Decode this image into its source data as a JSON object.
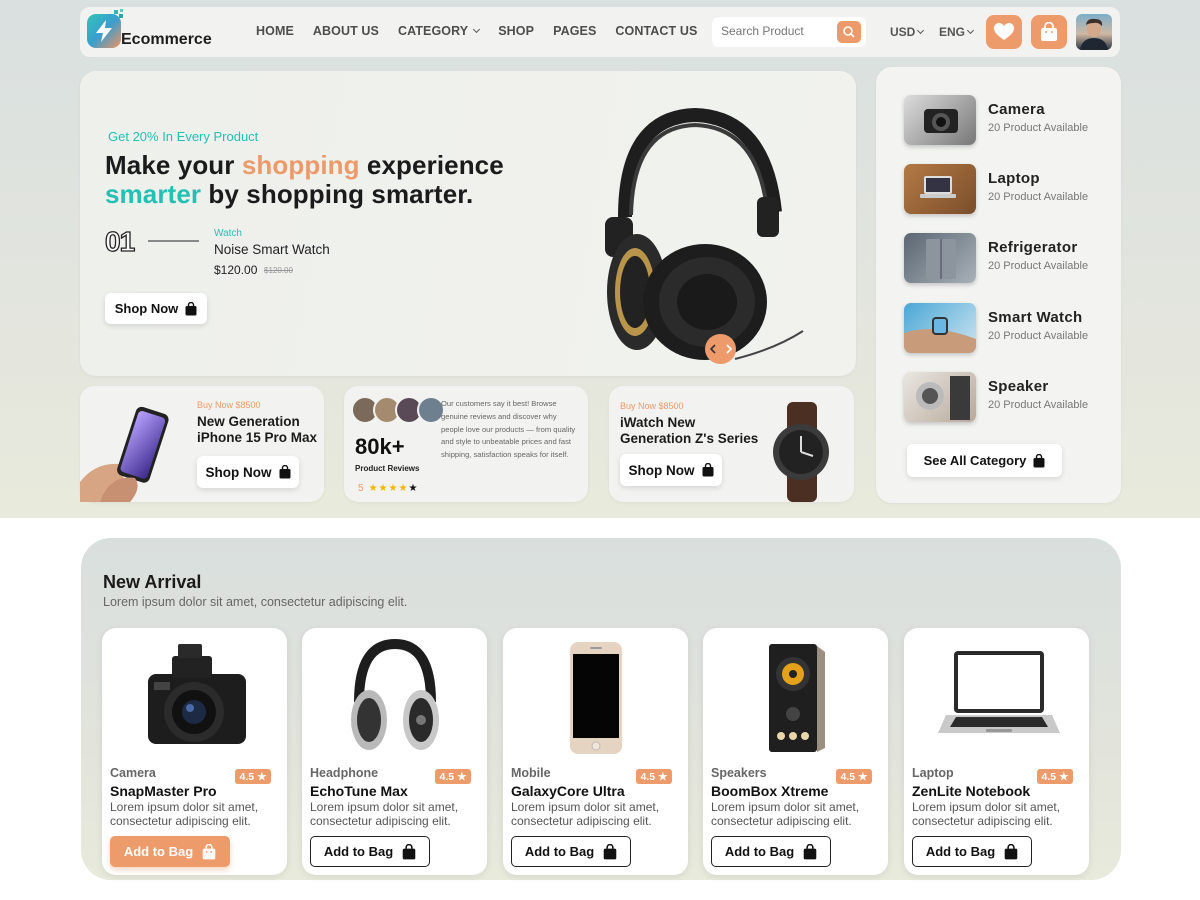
{
  "header": {
    "logo_text": "Ecommerce",
    "nav": [
      {
        "label": "HOME",
        "has_dropdown": false
      },
      {
        "label": "ABOUT US",
        "has_dropdown": false
      },
      {
        "label": "CATEGORY",
        "has_dropdown": true
      },
      {
        "label": "SHOP",
        "has_dropdown": false
      },
      {
        "label": "PAGES",
        "has_dropdown": false
      },
      {
        "label": "CONTACT US",
        "has_dropdown": false
      }
    ],
    "search_placeholder": "Search Product",
    "currency": "USD",
    "language": "ENG"
  },
  "hero": {
    "promo": "Get 20% In Every Product",
    "headline": {
      "part1": "Make your ",
      "highlight1": "shopping",
      "part2": " experience",
      "highlight2": "smarter",
      "part3": " by shopping smarter."
    },
    "slide_number": "01",
    "product_category": "Watch",
    "product_name": "Noise Smart Watch",
    "price": "$120.00",
    "old_price": "$120.00",
    "button": "Shop Now"
  },
  "categories": {
    "items": [
      {
        "name": "Camera",
        "count": "20 Product Available"
      },
      {
        "name": "Laptop",
        "count": "20 Product Available"
      },
      {
        "name": "Refrigerator",
        "count": "20 Product Available"
      },
      {
        "name": "Smart Watch",
        "count": "20 Product Available"
      },
      {
        "name": "Speaker",
        "count": "20 Product Available"
      }
    ],
    "see_all": "See All Category"
  },
  "promo_cards": {
    "iphone": {
      "buy": "Buy Now $8500",
      "title_line1": "New Generation",
      "title_line2": "iPhone 15 Pro Max",
      "button": "Shop Now"
    },
    "reviews": {
      "count": "80k+",
      "label": "Product Reviews",
      "rating": "5",
      "stars": 5,
      "text": "Our customers say it best! Browse genuine reviews and discover why people love our products — from quality and style to unbeatable prices and fast shipping, satisfaction speaks for itself."
    },
    "iwatch": {
      "buy": "Buy Now $8500",
      "title_line1": "iWatch New",
      "title_line2": "Generation  Z's Series",
      "button": "Shop Now"
    }
  },
  "new_arrival": {
    "title": "New Arrival",
    "subtitle": "Lorem ipsum dolor sit amet, consectetur adipiscing elit.",
    "products": [
      {
        "category": "Camera",
        "name": "SnapMaster Pro",
        "rating": "4.5",
        "desc": "Lorem ipsum dolor sit amet, consectetur adipiscing elit.",
        "button": "Add to Bag",
        "icon": "camera"
      },
      {
        "category": "Headphone",
        "name": "EchoTune Max",
        "rating": "4.5",
        "desc": "Lorem ipsum dolor sit amet, consectetur adipiscing elit.",
        "button": "Add to Bag",
        "icon": "headphone"
      },
      {
        "category": "Mobile",
        "name": "GalaxyCore Ultra",
        "rating": "4.5",
        "desc": "Lorem ipsum dolor sit amet, consectetur adipiscing elit.",
        "button": "Add to Bag",
        "icon": "mobile"
      },
      {
        "category": "Speakers",
        "name": "BoomBox Xtreme",
        "rating": "4.5",
        "desc": "Lorem ipsum dolor sit amet, consectetur adipiscing elit.",
        "button": "Add to Bag",
        "icon": "speaker"
      },
      {
        "category": "Laptop",
        "name": "ZenLite Notebook",
        "rating": "4.5",
        "desc": "Lorem ipsum dolor sit amet, consectetur adipiscing elit.",
        "button": "Add to Bag",
        "icon": "laptop"
      }
    ]
  },
  "colors": {
    "accent": "#ee9b6c",
    "teal": "#23c0b3",
    "text": "#1b1b1b"
  }
}
